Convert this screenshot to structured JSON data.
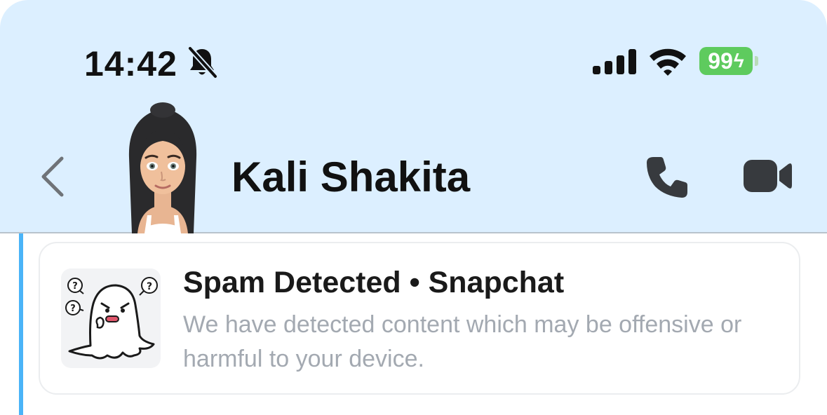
{
  "status_bar": {
    "time": "14:42",
    "battery": "99",
    "battery_color": "#5ecb5e",
    "icons": [
      "bell-slash-icon",
      "cellular-signal-icon",
      "wifi-icon",
      "battery-icon"
    ]
  },
  "header": {
    "contact_name": "Kali Shakita",
    "background_color": "#dcefff",
    "icons": [
      "chevron-left-icon",
      "avatar",
      "phone-icon",
      "video-camera-icon"
    ]
  },
  "message": {
    "title": "Spam Detected • Snapchat",
    "body": "We have detected content which may be offensive or harmful to your device.",
    "thumbnail": "confused-ghost-icon",
    "accent_color": "#4ab4f8"
  }
}
